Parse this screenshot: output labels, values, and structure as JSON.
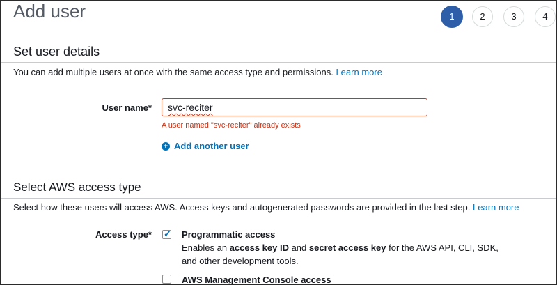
{
  "page": {
    "title": "Add user"
  },
  "steps": [
    "1",
    "2",
    "3",
    "4"
  ],
  "active_step": "1",
  "user_details": {
    "heading": "Set user details",
    "description": "You can add multiple users at once with the same access type and permissions.",
    "learn_more": "Learn more",
    "user_name_label": "User name*",
    "user_name_value": "svc-reciter",
    "error_message": "A user named \"svc-reciter\" already exists",
    "add_another_user": "Add another user"
  },
  "access_type": {
    "heading": "Select AWS access type",
    "description": "Select how these users will access AWS. Access keys and autogenerated passwords are provided in the last step.",
    "learn_more": "Learn more",
    "label": "Access type*",
    "options": [
      {
        "title": "Programmatic access",
        "checked": true,
        "desc_prefix": "Enables an ",
        "desc_bold1": "access key ID",
        "desc_mid": " and ",
        "desc_bold2": "secret access key",
        "desc_suffix": " for the AWS API, CLI, SDK, and other development tools."
      },
      {
        "title": "AWS Management Console access",
        "checked": false
      }
    ]
  },
  "colors": {
    "accent": "#2e5ea8",
    "link": "#0073bb",
    "error": "#d13212"
  }
}
